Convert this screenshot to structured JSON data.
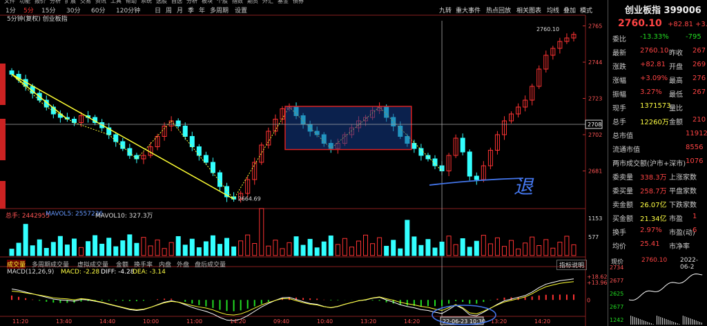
{
  "menu": [
    "文件",
    "功能",
    "报价",
    "分析",
    "扩展",
    "交易",
    "资讯",
    "工具",
    "帮助",
    "系统",
    "选股",
    "自选",
    "分析",
    "板块",
    "个股",
    "指数",
    "期货",
    "外汇",
    "基金",
    "债券"
  ],
  "toolbar": {
    "timeframes": [
      "1分钟",
      "5分钟",
      "15分钟",
      "30分钟",
      "60分钟",
      "120分钟",
      "日",
      "周",
      "月",
      "季",
      "年",
      "多周期",
      "设置"
    ],
    "timeframe_labels": [
      "1分",
      "5分",
      "15分",
      "30分",
      "60分",
      "120分钟",
      "日",
      "周",
      "月",
      "季",
      "年",
      "多周期",
      "设置"
    ],
    "active": "5分",
    "right_tabs": [
      "九转",
      "重大事件",
      "热点回放",
      "相关图表",
      "均线",
      "叠加",
      "模式"
    ]
  },
  "chart": {
    "subtitle": "5分钟(复权) 创业板指",
    "annotations": {
      "high": "2760.10",
      "low": "2664.69",
      "crosshair_price": "2708",
      "crosshair_time": "22-06-23 10:30",
      "handwriting": "退"
    },
    "price_axis": [
      "2765",
      "2744",
      "2723",
      "2702",
      "2681"
    ],
    "volume_header": {
      "label1": "总手: 2442955",
      "label2": "MAVOL5: 2557236",
      "label3": "MAVOL10: 327.3万"
    },
    "volume_axis": [
      "1153",
      "577"
    ],
    "tabs": [
      "成交量",
      "多周期成交量",
      "虚拟成交量",
      "金额",
      "换手率",
      "内盘",
      "外盘",
      "盘后成交量"
    ],
    "indicator_button": "指标说明",
    "macd_header": {
      "title": "MACD(12,26,9)",
      "macd": "MACD: -2.28",
      "diff": "DIFF: -4.28",
      "dea": "DEA: -3.14"
    },
    "macd_axis": [
      "+18.62",
      "+13.96",
      "0"
    ],
    "time_axis": [
      "11:20",
      "13:40",
      "14:40",
      "10:00",
      "11:00",
      "14:20",
      "09:40",
      "10:40",
      "13:20",
      "14:20",
      "09:40",
      "13:20",
      "14:20"
    ]
  },
  "chart_data": {
    "type": "candlestick",
    "price_ylim": [
      2660,
      2768
    ],
    "closes": [
      2737,
      2734,
      2730,
      2726,
      2722,
      2718,
      2714,
      2712,
      2711,
      2709,
      2713,
      2712,
      2709,
      2706,
      2702,
      2698,
      2694,
      2690,
      2688,
      2690,
      2695,
      2701,
      2707,
      2710,
      2707,
      2701,
      2695,
      2690,
      2686,
      2680,
      2672,
      2666,
      2664.69,
      2668,
      2676,
      2686,
      2696,
      2704,
      2711,
      2717,
      2718,
      2713,
      2708,
      2704,
      2702,
      2697,
      2694,
      2697,
      2702,
      2706,
      2710,
      2712,
      2716,
      2718,
      2712,
      2707,
      2701,
      2697,
      2694,
      2690,
      2688,
      2684,
      2681,
      2690,
      2700,
      2692,
      2678,
      2676,
      2684,
      2693,
      2702,
      2710,
      2714,
      2718,
      2722,
      2730,
      2740,
      2748,
      2752,
      2756,
      2758,
      2760.1
    ],
    "volume_ylim": [
      0,
      1200
    ],
    "macd_ylim": [
      -12,
      20
    ]
  },
  "panel": {
    "title": "创业板指 399006",
    "price": "2760.10",
    "change": "+82.81",
    "change_pct": "+3.0",
    "rows": [
      {
        "k1": "委比",
        "v1": "-13.33%",
        "k2": "",
        "v2": "-795"
      },
      {
        "k1": "最新",
        "v1": "2760.10",
        "k2": "昨收",
        "v2": "267"
      },
      {
        "k1": "涨跌",
        "v1": "+82.81",
        "k2": "开盘",
        "v2": "269"
      },
      {
        "k1": "涨幅",
        "v1": "+3.09%",
        "k2": "最高",
        "v2": "276"
      },
      {
        "k1": "振幅",
        "v1": "3.27%",
        "k2": "最低",
        "v2": "267"
      },
      {
        "k1": "现手",
        "v1": "1371573",
        "k2": "量比",
        "v2": ""
      },
      {
        "k1": "总手",
        "v1": "12260万",
        "k2": "金额",
        "v2": "210"
      },
      {
        "k1": "总市值",
        "v1": "",
        "k2": "",
        "v2": "11912"
      },
      {
        "k1": "流通市值",
        "v1": "",
        "k2": "",
        "v2": "8556"
      },
      {
        "k1": "两市成交额(沪市+深市)",
        "v1": "",
        "k2": "",
        "v2": "1076"
      },
      {
        "k1": "委卖量",
        "v1": "338.3万",
        "k2": "上涨家数",
        "v2": ""
      },
      {
        "k1": "委买量",
        "v1": "258.7万",
        "k2": "平盘家数",
        "v2": ""
      },
      {
        "k1": "卖金额",
        "v1": "26.07亿",
        "k2": "下跌家数",
        "v2": ""
      },
      {
        "k1": "买金额",
        "v1": "21.34亿",
        "k2": "市盈",
        "v2": "1"
      },
      {
        "k1": "换手",
        "v1": "2.97%",
        "k2": "市盈(动)",
        "v2": "6"
      },
      {
        "k1": "均价",
        "v1": "25.41",
        "k2": "市净率",
        "v2": ""
      }
    ],
    "mini": {
      "label": "现价",
      "price": "2760.10",
      "date": "2022-06-2",
      "axis": [
        "2734",
        "2677",
        "2625",
        "2677",
        "1242"
      ]
    }
  }
}
